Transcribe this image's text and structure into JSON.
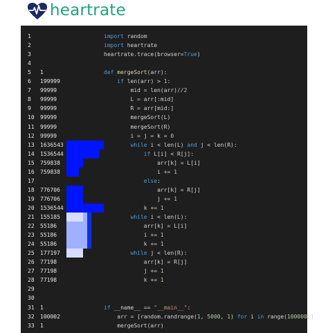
{
  "header": {
    "logo_text": "heartrate",
    "logo_icon": "heart-pulse-icon",
    "brand_color": "#1fa37e"
  },
  "heat_colors": {
    "strong": "#0015ff",
    "medium": "#1230e0",
    "light": "#9eb0ff",
    "pale": "#d8ddff"
  },
  "lines": [
    {
      "n": "1",
      "hits": "",
      "code": [
        [
          "kw",
          "import"
        ],
        [
          "op",
          " random"
        ]
      ]
    },
    {
      "n": "2",
      "hits": "",
      "code": [
        [
          "kw",
          "import"
        ],
        [
          "op",
          " heartrate"
        ]
      ]
    },
    {
      "n": "3",
      "hits": "",
      "code": [
        [
          "op",
          "heartrate.trace(browser"
        ],
        [
          "op",
          "="
        ],
        [
          "kw",
          "True"
        ],
        [
          "op",
          ")"
        ]
      ]
    },
    {
      "n": "4",
      "hits": "",
      "code": []
    },
    {
      "n": "5",
      "hits": "1",
      "code": [
        [
          "kw",
          "def"
        ],
        [
          "fn",
          " mergeSort"
        ],
        [
          "op",
          "(arr):"
        ]
      ]
    },
    {
      "n": "6",
      "hits": "199999",
      "code": [
        [
          "op",
          "    "
        ],
        [
          "kw",
          "if"
        ],
        [
          "op",
          " len(arr) "
        ],
        [
          "op",
          ">"
        ],
        [
          "num",
          " 1"
        ],
        [
          "op",
          ":"
        ]
      ]
    },
    {
      "n": "7",
      "hits": "99999",
      "code": [
        [
          "op",
          "        mid = len(arr)"
        ],
        [
          "op",
          "//"
        ],
        [
          "num",
          "2"
        ]
      ]
    },
    {
      "n": "8",
      "hits": "99999",
      "code": [
        [
          "op",
          "        L = arr[:mid]"
        ]
      ]
    },
    {
      "n": "9",
      "hits": "99999",
      "code": [
        [
          "op",
          "        R = arr[mid:]"
        ]
      ]
    },
    {
      "n": "10",
      "hits": "99999",
      "code": [
        [
          "op",
          "        mergeSort(L)"
        ]
      ]
    },
    {
      "n": "11",
      "hits": "99999",
      "code": [
        [
          "op",
          "        mergeSort(R)"
        ]
      ]
    },
    {
      "n": "12",
      "hits": "99999",
      "code": [
        [
          "op",
          "        i = j = k = "
        ],
        [
          "num",
          "0"
        ]
      ]
    },
    {
      "n": "13",
      "hits": "1636543",
      "code": [
        [
          "op",
          "        "
        ],
        [
          "kw",
          "while"
        ],
        [
          "op",
          " i < len(L) "
        ],
        [
          "kw",
          "and"
        ],
        [
          "op",
          " j < len(R):"
        ]
      ]
    },
    {
      "n": "14",
      "hits": "1536544",
      "code": [
        [
          "op",
          "            "
        ],
        [
          "kw",
          "if"
        ],
        [
          "op",
          " L[i] < R[j]:"
        ]
      ]
    },
    {
      "n": "15",
      "hits": "759838",
      "code": [
        [
          "op",
          "                arr[k] = L[i]"
        ]
      ]
    },
    {
      "n": "16",
      "hits": "759838",
      "code": [
        [
          "op",
          "                i "
        ],
        [
          "op",
          "+="
        ],
        [
          "num",
          " 1"
        ]
      ]
    },
    {
      "n": "17",
      "hits": "",
      "code": [
        [
          "op",
          "            "
        ],
        [
          "kw",
          "else"
        ],
        [
          "op",
          ":"
        ]
      ]
    },
    {
      "n": "18",
      "hits": "776706",
      "code": [
        [
          "op",
          "                arr[k] = R[j]"
        ]
      ]
    },
    {
      "n": "19",
      "hits": "776706",
      "code": [
        [
          "op",
          "                j "
        ],
        [
          "op",
          "+="
        ],
        [
          "num",
          " 1"
        ]
      ]
    },
    {
      "n": "20",
      "hits": "1536544",
      "code": [
        [
          "op",
          "            k "
        ],
        [
          "op",
          "+="
        ],
        [
          "num",
          " 1"
        ]
      ]
    },
    {
      "n": "21",
      "hits": "155185",
      "code": [
        [
          "op",
          "        "
        ],
        [
          "kw",
          "while"
        ],
        [
          "op",
          " i < len(L):"
        ]
      ]
    },
    {
      "n": "22",
      "hits": "55186",
      "code": [
        [
          "op",
          "            arr[k] = L[i]"
        ]
      ]
    },
    {
      "n": "23",
      "hits": "55186",
      "code": [
        [
          "op",
          "            i "
        ],
        [
          "op",
          "+="
        ],
        [
          "num",
          " 1"
        ]
      ]
    },
    {
      "n": "24",
      "hits": "55186",
      "code": [
        [
          "op",
          "            k "
        ],
        [
          "op",
          "+="
        ],
        [
          "num",
          " 1"
        ]
      ]
    },
    {
      "n": "25",
      "hits": "177197",
      "code": [
        [
          "op",
          "        "
        ],
        [
          "kw",
          "while"
        ],
        [
          "op",
          " j < len(R):"
        ]
      ]
    },
    {
      "n": "26",
      "hits": "77198",
      "code": [
        [
          "op",
          "            arr[k] = R[j]"
        ]
      ]
    },
    {
      "n": "27",
      "hits": "77198",
      "code": [
        [
          "op",
          "            j "
        ],
        [
          "op",
          "+="
        ],
        [
          "num",
          " 1"
        ]
      ]
    },
    {
      "n": "28",
      "hits": "77198",
      "code": [
        [
          "op",
          "            k "
        ],
        [
          "op",
          "+="
        ],
        [
          "num",
          " 1"
        ]
      ]
    },
    {
      "n": "29",
      "hits": "",
      "code": []
    },
    {
      "n": "30",
      "hits": "",
      "code": []
    },
    {
      "n": "31",
      "hits": "1",
      "code": [
        [
          "kw",
          "if"
        ],
        [
          "op",
          " __name__ "
        ],
        [
          "op",
          "=="
        ],
        [
          "str",
          " \"__main__\""
        ],
        [
          "op",
          ":"
        ]
      ]
    },
    {
      "n": "32",
      "hits": "100002",
      "code": [
        [
          "op",
          "    arr = [random.randrange("
        ],
        [
          "num",
          "1"
        ],
        [
          "op",
          ", "
        ],
        [
          "num",
          "5000"
        ],
        [
          "op",
          ", "
        ],
        [
          "num",
          "1"
        ],
        [
          "op",
          ") "
        ],
        [
          "kw",
          "for"
        ],
        [
          "op",
          " i "
        ],
        [
          "kw",
          "in"
        ],
        [
          "op",
          " range("
        ],
        [
          "num",
          "100000"
        ],
        [
          "op",
          ")]"
        ]
      ]
    },
    {
      "n": "33",
      "hits": "1",
      "code": [
        [
          "op",
          "    mergeSort(arr)"
        ]
      ]
    }
  ],
  "heatmap_rows": [
    {
      "line": "13",
      "level": 1.0,
      "cells": [
        4,
        4,
        4,
        4,
        4,
        4,
        4,
        4,
        4
      ]
    },
    {
      "line": "14",
      "level": 0.94,
      "cells": [
        4,
        4,
        4,
        4,
        4,
        4,
        4,
        4,
        0
      ]
    },
    {
      "line": "15",
      "level": 0.46,
      "cells": [
        4,
        4,
        4,
        4,
        0,
        0,
        0,
        0,
        0
      ]
    },
    {
      "line": "16",
      "level": 0.46,
      "cells": [
        4,
        4,
        4,
        0,
        0,
        0,
        0,
        0,
        0
      ]
    },
    {
      "line": "18",
      "level": 0.47,
      "cells": [
        4,
        4,
        4,
        4,
        0,
        0,
        0,
        0,
        0
      ]
    },
    {
      "line": "19",
      "level": 0.47,
      "cells": [
        4,
        4,
        4,
        4,
        0,
        0,
        0,
        0,
        0
      ]
    },
    {
      "line": "20",
      "level": 0.94,
      "cells": [
        4,
        4,
        4,
        4,
        4,
        4,
        4,
        4,
        4
      ]
    },
    {
      "line": "21",
      "level": 0.09,
      "cells": [
        1,
        1,
        1,
        1,
        2,
        3,
        0,
        0,
        0
      ]
    },
    {
      "line": "22",
      "level": 0.03,
      "cells": [
        2,
        2,
        2,
        2,
        2,
        3,
        0,
        0,
        0
      ]
    },
    {
      "line": "23",
      "level": 0.03,
      "cells": [
        2,
        2,
        2,
        2,
        2,
        3,
        0,
        0,
        0
      ]
    },
    {
      "line": "24",
      "level": 0.03,
      "cells": [
        2,
        2,
        2,
        2,
        2,
        3,
        0,
        0,
        0
      ]
    },
    {
      "line": "25",
      "level": 0.11,
      "cells": [
        1,
        1,
        1,
        1,
        0,
        0,
        0,
        0,
        0
      ]
    }
  ]
}
